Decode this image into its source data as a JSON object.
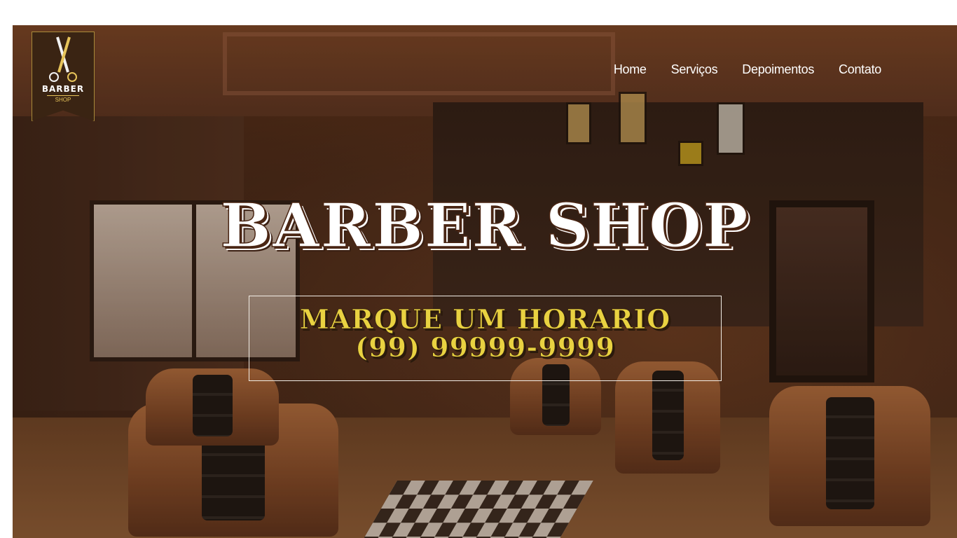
{
  "logo": {
    "name": "BARBER",
    "sub": "SHOP",
    "icon": "scissors-icon",
    "accent": "#e7c45a",
    "badge_color": "#3a2413"
  },
  "nav": {
    "items": [
      {
        "label": "Home"
      },
      {
        "label": "Serviços"
      },
      {
        "label": "Depoimentos"
      },
      {
        "label": "Contato"
      }
    ]
  },
  "hero": {
    "title": "BARBER SHOP",
    "cta_line1": "MARQUE UM HORARIO",
    "cta_line2": "(99) 99999-9999",
    "cta_color": "#e9d241"
  }
}
